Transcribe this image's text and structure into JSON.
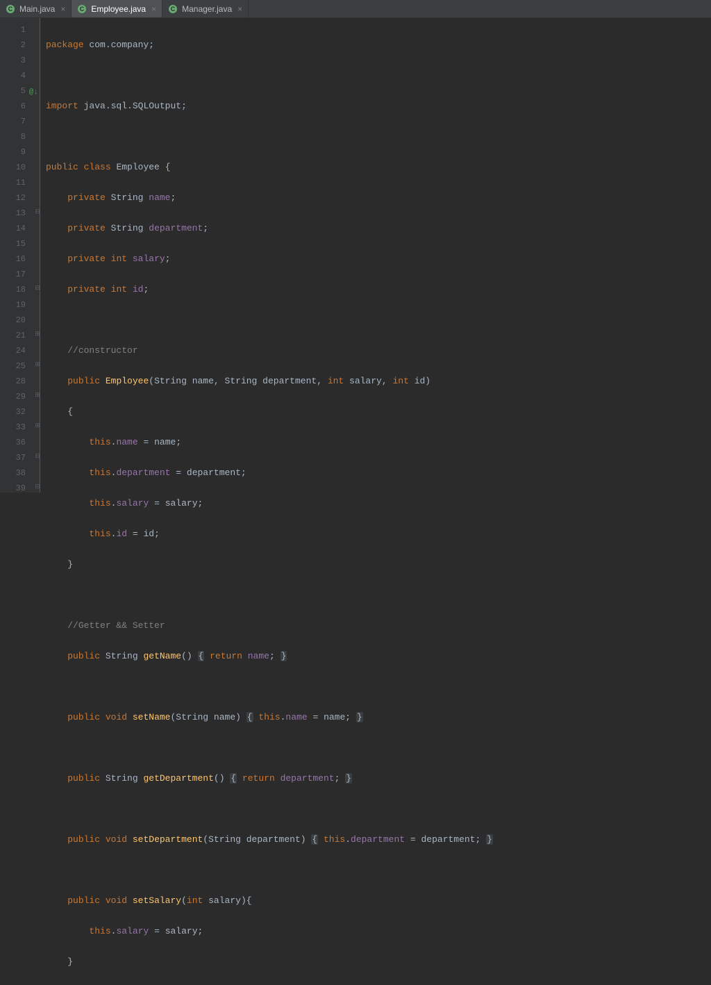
{
  "tabs": [
    {
      "label": "Main.java",
      "active": false
    },
    {
      "label": "Employee.java",
      "active": true
    },
    {
      "label": "Manager.java",
      "active": false
    }
  ],
  "gutter": {
    "lines": [
      "1",
      "2",
      "3",
      "4",
      "5",
      "6",
      "7",
      "8",
      "9",
      "10",
      "11",
      "12",
      "13",
      "14",
      "15",
      "16",
      "17",
      "18",
      "19",
      "20",
      "21",
      "24",
      "25",
      "28",
      "29",
      "32",
      "33",
      "36",
      "37",
      "38",
      "39"
    ],
    "markers": {
      "5": "@↓"
    },
    "folds": {
      "13": "⊟",
      "18": "⊟",
      "21": "⊞",
      "25": "⊞",
      "29": "⊞",
      "33": "⊞",
      "37": "⊟",
      "39": "⊟"
    }
  },
  "tokens": {
    "package": "package",
    "import": "import",
    "public": "public",
    "class": "class",
    "private": "private",
    "void": "void",
    "int": "int",
    "this": "this",
    "return": "return",
    "String": "String",
    "Employee": "Employee",
    "name": "name",
    "department": "department",
    "salary": "salary",
    "id": "id",
    "getName": "getName",
    "setName": "setName",
    "getDepartment": "getDepartment",
    "setDepartment": "setDepartment",
    "setSalary": "setSalary",
    "com_company": "com.company",
    "sqloutput": "java.sql.SQLOutput",
    "comment_constructor": "//constructor",
    "comment_getter": "//Getter && Setter"
  }
}
